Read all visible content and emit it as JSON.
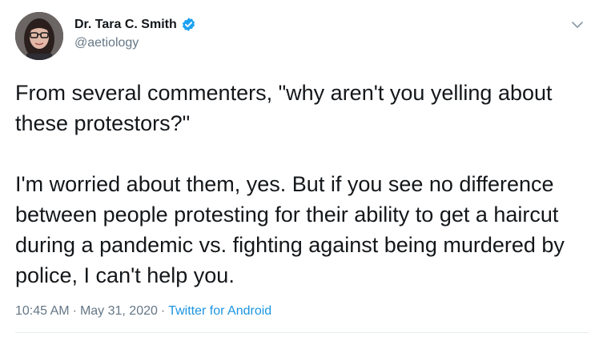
{
  "author": {
    "display_name": "Dr. Tara C. Smith",
    "handle": "@aetiology",
    "verified": true,
    "avatar_icon": "profile-photo-woman-glasses"
  },
  "tweet": {
    "text": "From several commenters, \"why aren't you yelling about these protestors?\"\n\nI'm worried about them, yes. But if you see no difference between people protesting for their ability to get a haircut during a pandemic vs. fighting against being murdered by police, I can't help you.",
    "time": "10:45 AM",
    "separator": "·",
    "date": "May 31, 2020",
    "source": "Twitter for Android"
  },
  "colors": {
    "text": "#14171a",
    "secondary": "#657786",
    "link": "#1b95e0",
    "verified_badge": "#1da1f2",
    "divider": "#e6ecf0"
  },
  "menu": {
    "icon": "chevron-down-icon"
  }
}
